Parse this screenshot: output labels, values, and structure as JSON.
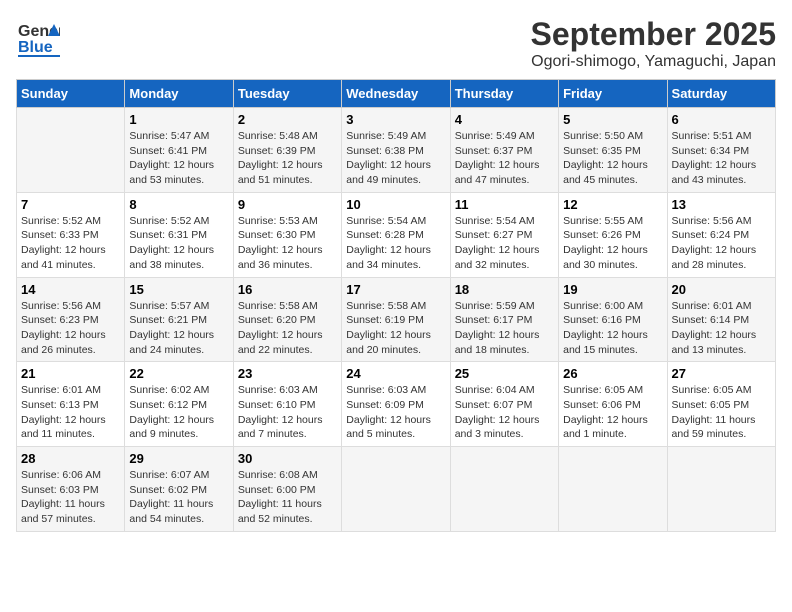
{
  "logo": {
    "line1": "General",
    "line2": "Blue"
  },
  "title": "September 2025",
  "subtitle": "Ogori-shimogo, Yamaguchi, Japan",
  "weekdays": [
    "Sunday",
    "Monday",
    "Tuesday",
    "Wednesday",
    "Thursday",
    "Friday",
    "Saturday"
  ],
  "weeks": [
    [
      {
        "day": "",
        "info": ""
      },
      {
        "day": "1",
        "info": "Sunrise: 5:47 AM\nSunset: 6:41 PM\nDaylight: 12 hours\nand 53 minutes."
      },
      {
        "day": "2",
        "info": "Sunrise: 5:48 AM\nSunset: 6:39 PM\nDaylight: 12 hours\nand 51 minutes."
      },
      {
        "day": "3",
        "info": "Sunrise: 5:49 AM\nSunset: 6:38 PM\nDaylight: 12 hours\nand 49 minutes."
      },
      {
        "day": "4",
        "info": "Sunrise: 5:49 AM\nSunset: 6:37 PM\nDaylight: 12 hours\nand 47 minutes."
      },
      {
        "day": "5",
        "info": "Sunrise: 5:50 AM\nSunset: 6:35 PM\nDaylight: 12 hours\nand 45 minutes."
      },
      {
        "day": "6",
        "info": "Sunrise: 5:51 AM\nSunset: 6:34 PM\nDaylight: 12 hours\nand 43 minutes."
      }
    ],
    [
      {
        "day": "7",
        "info": "Sunrise: 5:52 AM\nSunset: 6:33 PM\nDaylight: 12 hours\nand 41 minutes."
      },
      {
        "day": "8",
        "info": "Sunrise: 5:52 AM\nSunset: 6:31 PM\nDaylight: 12 hours\nand 38 minutes."
      },
      {
        "day": "9",
        "info": "Sunrise: 5:53 AM\nSunset: 6:30 PM\nDaylight: 12 hours\nand 36 minutes."
      },
      {
        "day": "10",
        "info": "Sunrise: 5:54 AM\nSunset: 6:28 PM\nDaylight: 12 hours\nand 34 minutes."
      },
      {
        "day": "11",
        "info": "Sunrise: 5:54 AM\nSunset: 6:27 PM\nDaylight: 12 hours\nand 32 minutes."
      },
      {
        "day": "12",
        "info": "Sunrise: 5:55 AM\nSunset: 6:26 PM\nDaylight: 12 hours\nand 30 minutes."
      },
      {
        "day": "13",
        "info": "Sunrise: 5:56 AM\nSunset: 6:24 PM\nDaylight: 12 hours\nand 28 minutes."
      }
    ],
    [
      {
        "day": "14",
        "info": "Sunrise: 5:56 AM\nSunset: 6:23 PM\nDaylight: 12 hours\nand 26 minutes."
      },
      {
        "day": "15",
        "info": "Sunrise: 5:57 AM\nSunset: 6:21 PM\nDaylight: 12 hours\nand 24 minutes."
      },
      {
        "day": "16",
        "info": "Sunrise: 5:58 AM\nSunset: 6:20 PM\nDaylight: 12 hours\nand 22 minutes."
      },
      {
        "day": "17",
        "info": "Sunrise: 5:58 AM\nSunset: 6:19 PM\nDaylight: 12 hours\nand 20 minutes."
      },
      {
        "day": "18",
        "info": "Sunrise: 5:59 AM\nSunset: 6:17 PM\nDaylight: 12 hours\nand 18 minutes."
      },
      {
        "day": "19",
        "info": "Sunrise: 6:00 AM\nSunset: 6:16 PM\nDaylight: 12 hours\nand 15 minutes."
      },
      {
        "day": "20",
        "info": "Sunrise: 6:01 AM\nSunset: 6:14 PM\nDaylight: 12 hours\nand 13 minutes."
      }
    ],
    [
      {
        "day": "21",
        "info": "Sunrise: 6:01 AM\nSunset: 6:13 PM\nDaylight: 12 hours\nand 11 minutes."
      },
      {
        "day": "22",
        "info": "Sunrise: 6:02 AM\nSunset: 6:12 PM\nDaylight: 12 hours\nand 9 minutes."
      },
      {
        "day": "23",
        "info": "Sunrise: 6:03 AM\nSunset: 6:10 PM\nDaylight: 12 hours\nand 7 minutes."
      },
      {
        "day": "24",
        "info": "Sunrise: 6:03 AM\nSunset: 6:09 PM\nDaylight: 12 hours\nand 5 minutes."
      },
      {
        "day": "25",
        "info": "Sunrise: 6:04 AM\nSunset: 6:07 PM\nDaylight: 12 hours\nand 3 minutes."
      },
      {
        "day": "26",
        "info": "Sunrise: 6:05 AM\nSunset: 6:06 PM\nDaylight: 12 hours\nand 1 minute."
      },
      {
        "day": "27",
        "info": "Sunrise: 6:05 AM\nSunset: 6:05 PM\nDaylight: 11 hours\nand 59 minutes."
      }
    ],
    [
      {
        "day": "28",
        "info": "Sunrise: 6:06 AM\nSunset: 6:03 PM\nDaylight: 11 hours\nand 57 minutes."
      },
      {
        "day": "29",
        "info": "Sunrise: 6:07 AM\nSunset: 6:02 PM\nDaylight: 11 hours\nand 54 minutes."
      },
      {
        "day": "30",
        "info": "Sunrise: 6:08 AM\nSunset: 6:00 PM\nDaylight: 11 hours\nand 52 minutes."
      },
      {
        "day": "",
        "info": ""
      },
      {
        "day": "",
        "info": ""
      },
      {
        "day": "",
        "info": ""
      },
      {
        "day": "",
        "info": ""
      }
    ]
  ]
}
